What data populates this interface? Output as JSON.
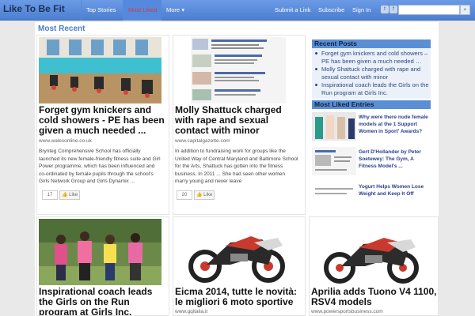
{
  "nav": {
    "brand": "Like To Be Fit",
    "items": [
      "Top Stories",
      "Most Liked",
      "More"
    ],
    "more_arrow": "▾",
    "right": [
      "Submit a Link",
      "Subscribe",
      "Sign In"
    ],
    "social": [
      "twitter-icon",
      "facebook-icon"
    ],
    "search_placeholder": ""
  },
  "main": {
    "section_title": "Most Recent",
    "cards": [
      {
        "title": "Forget gym knickers and cold showers - PE has been given a much needed ...",
        "source": "www.walesonline.co.uk",
        "excerpt": "Brynteg Comprehensive School has officially launched its new female-friendly fitness suite and Girl Power programme, which has been influenced and co-ordinated by female pupils through the school's Girls Network Group and Girls Dynamix ...",
        "likes": "17",
        "like_label": "Like"
      },
      {
        "title": "Molly Shattuck charged with rape and sexual contact with minor",
        "source": "www.capitalgazette.com",
        "excerpt": "In addition to fundraising work for groups like the United Way of Central Maryland and Baltimore School for the Arts, Shattuck has gotten into the fitness business. In 2011 ... She had seen other women marry young and never leave",
        "likes": "20",
        "like_label": "Like"
      },
      {
        "title": "Inspirational coach leads the Girls on the Run program at Girls Inc.",
        "source": ""
      },
      {
        "title": "Eicma 2014, tutte le novità: le migliori 6 moto sportive",
        "source": "www.gqitalia.it"
      },
      {
        "title": "Aprilia adds Tuono V4 1100, RSV4 models",
        "source": "www.powersportsbusiness.com"
      }
    ]
  },
  "sidebar": {
    "recent_title": "Recent Posts",
    "recent": [
      "Forget gym knickers and cold showers – PE has been given a much needed …",
      "Molly Shattuck charged with rape and sexual contact with minor",
      "Inspirational coach leads the Girls on the Run program at Girls Inc."
    ],
    "liked_title": "Most Liked Entries",
    "liked": [
      "Why were there nude female models at the 1 Support Women in Sport' Awards?",
      "Gert D'Hollander by Peter Soetewey: The Gym, A Fitness Model's ...",
      "Yogurt Helps Women Lose Weight and Keep It Off"
    ]
  },
  "colors": {
    "nav": "#4d7fd1",
    "accent": "#4a7ec6",
    "selected": "#d23b3b"
  }
}
